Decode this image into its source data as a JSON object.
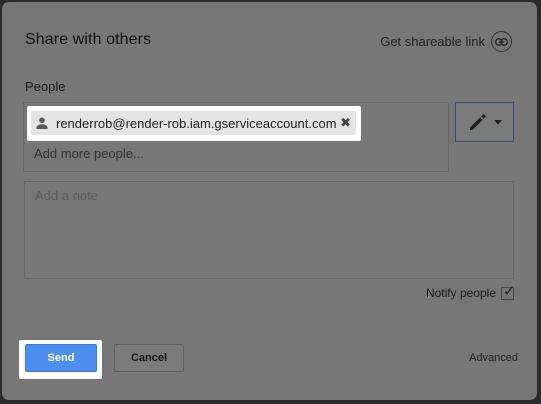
{
  "dialog": {
    "title": "Share with others",
    "share_link_label": "Get shareable link"
  },
  "people": {
    "section_label": "People",
    "chips": [
      {
        "email": "renderrob@render-rob.iam.gserviceaccount.com",
        "remove_glyph": "✖"
      }
    ],
    "add_placeholder": "Add more people..."
  },
  "note": {
    "placeholder": "Add a note"
  },
  "notify": {
    "label": "Notify people",
    "checked": true
  },
  "footer": {
    "send_label": "Send",
    "cancel_label": "Cancel",
    "advanced_label": "Advanced"
  },
  "colors": {
    "overlay_dialog": "#777777",
    "send_blue": "#4d8ff0",
    "edit_border": "#3a4a80"
  },
  "icons": {
    "share_link": "link-icon",
    "person": "person-icon",
    "remove": "close-icon",
    "permission": "pencil-icon",
    "dropdown": "caret-down-icon",
    "check": "checkmark-icon"
  }
}
